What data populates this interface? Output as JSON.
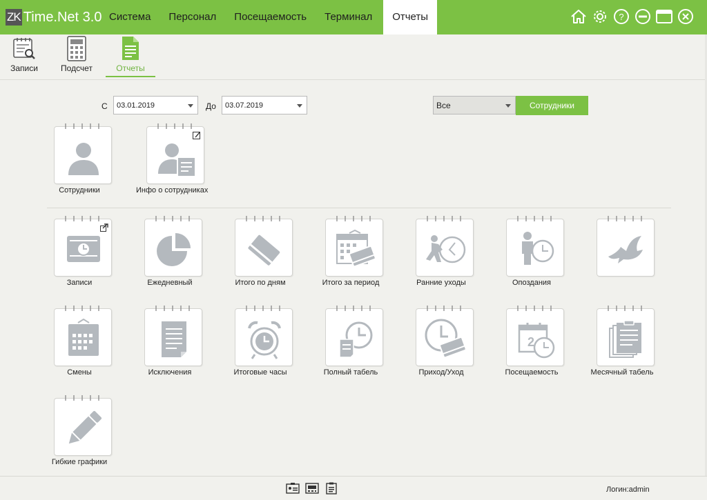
{
  "app": {
    "logo_mark": "ZK",
    "product_title": "Time.Net 3.0"
  },
  "menu": [
    {
      "label": "Система",
      "active": false
    },
    {
      "label": "Персонал",
      "active": false
    },
    {
      "label": "Посещаемость",
      "active": false
    },
    {
      "label": "Терминал",
      "active": false
    },
    {
      "label": "Отчеты",
      "active": true
    }
  ],
  "window_buttons": [
    "home-icon",
    "gear-icon",
    "help-icon",
    "minimize-icon",
    "maximize-icon",
    "close-icon"
  ],
  "toolbar": {
    "records": {
      "label": "Записи",
      "icon": "records-search-icon"
    },
    "calc": {
      "label": "Подсчет",
      "icon": "calculator-icon"
    },
    "reports": {
      "label": "Отчеты",
      "icon": "report-document-icon",
      "selected": true
    }
  },
  "filters": {
    "from_label": "С",
    "from_date": "03.01.2019",
    "to_label": "До",
    "to_date": "03.07.2019",
    "scope_value": "Все",
    "employees_button": "Сотрудники"
  },
  "personnel_tiles": [
    {
      "label": "Сотрудники",
      "icon": "person-icon"
    },
    {
      "label": "Инфо о сотрудниках",
      "icon": "person-info-icon",
      "corner": "edit-icon"
    }
  ],
  "report_tiles": [
    {
      "label": "Записи",
      "icon": "records-clock-icon",
      "corner": "export-icon"
    },
    {
      "label": "Ежедневный",
      "icon": "pie-chart-icon"
    },
    {
      "label": "Итого по дням",
      "icon": "card-icon"
    },
    {
      "label": "Итого за период",
      "icon": "calendar-card-icon"
    },
    {
      "label": "Ранние уходы",
      "icon": "early-leave-icon"
    },
    {
      "label": "Опоздания",
      "icon": "late-arrival-icon"
    },
    {
      "label": "",
      "icon": "dove-icon"
    },
    {
      "label": "Смены",
      "icon": "shift-calendar-icon"
    },
    {
      "label": "Исключения",
      "icon": "document-icon"
    },
    {
      "label": "Итоговые часы",
      "icon": "alarm-clock-icon"
    },
    {
      "label": "Полный табель",
      "icon": "timesheet-clock-icon"
    },
    {
      "label": "Приход/Уход",
      "icon": "clock-in-out-icon"
    },
    {
      "label": "Посещаемость",
      "icon": "attendance-calendar-icon"
    },
    {
      "label": "Месячный табель",
      "icon": "monthly-sheets-icon"
    },
    {
      "label": "Гибкие графики",
      "icon": "pencil-icon"
    }
  ],
  "status": {
    "icons": [
      "id-card-icon",
      "device-icon",
      "clipboard-icon"
    ],
    "login_text": "Логин:admin"
  },
  "colors": {
    "accent": "#7cc144",
    "icon_grey": "#b4b9be",
    "background": "#f1f1ed"
  }
}
